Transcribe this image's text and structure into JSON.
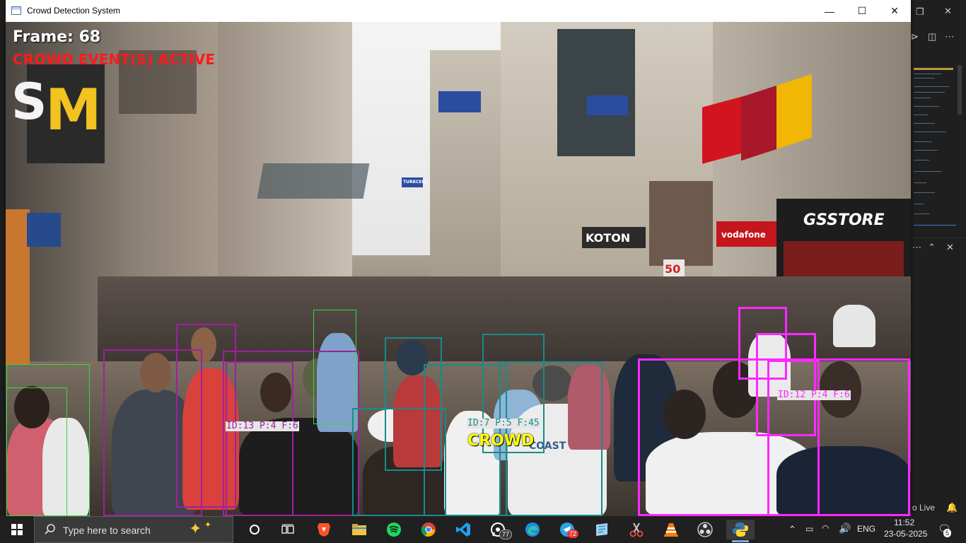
{
  "window": {
    "title": "Crowd Detection System",
    "controls": {
      "minimize": "—",
      "maximize": "☐",
      "close": "✕"
    }
  },
  "hud": {
    "frame_label": "Frame: 68",
    "event_label": "CROWD EVENT(S) ACTIVE",
    "crowd_label": "CROWD"
  },
  "detections": {
    "labeled_groups": [
      {
        "label": "ID:13 P:4 F:6",
        "color": "#a020a0"
      },
      {
        "label": "ID:7 P:5 F:45",
        "color": "#168c8c"
      },
      {
        "label": "ID:12 P:4 F:6",
        "color": "#ff28ff"
      }
    ],
    "colors": {
      "person_green": "#33dd33",
      "group_purple": "#a020a0",
      "group_teal": "#168c8c",
      "group_magenta": "#ff28ff"
    }
  },
  "scene_signs": {
    "mcdonalds": "M",
    "store_left": "S",
    "koton": "KOTON",
    "gs_store": "GSSTORE",
    "sale": "50",
    "vodafone": "vodafone",
    "turkcell": "TURKCELL",
    "shirt_text": "COAST GUARD"
  },
  "background_app": {
    "status_text": "o Live",
    "close_icon": "✕"
  },
  "taskbar": {
    "search_placeholder": "Type here to search",
    "whatsapp_badge": "77",
    "telegram_badge": "72",
    "language": "ENG",
    "time": "11:52",
    "date": "23-05-2025",
    "notification_count": "5"
  }
}
